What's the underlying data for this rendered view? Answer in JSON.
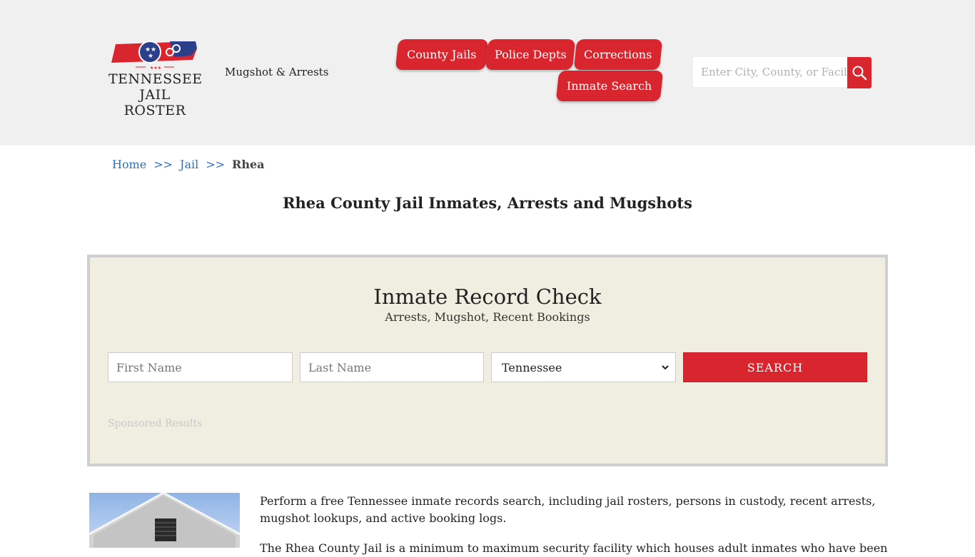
{
  "header": {
    "logo_line1": "TENNESSEE",
    "logo_line2": "JAIL ROSTER",
    "tagline": "Mugshot & Arrests",
    "nav": {
      "county_jails": "County Jails",
      "police_depts": "Police Depts",
      "corrections": "Corrections",
      "inmate_search": "Inmate Search"
    },
    "search_placeholder": "Enter City, County, or Facil"
  },
  "breadcrumb": {
    "home": "Home",
    "sep": ">>",
    "jail": "Jail",
    "current": "Rhea"
  },
  "page_title": "Rhea County Jail Inmates, Arrests and Mugshots",
  "record_check": {
    "title": "Inmate Record Check",
    "subtitle": "Arrests, Mugshot, Recent Bookings",
    "first_name_placeholder": "First Name",
    "last_name_placeholder": "Last Name",
    "state_selected": "Tennessee",
    "search_button": "SEARCH",
    "sponsored": "Sponsored Results"
  },
  "content": {
    "paragraph1": "Perform a free Tennessee inmate records search, including jail rosters, persons in custody, recent arrests, mugshot lookups, and active booking logs.",
    "paragraph2": "The Rhea County Jail is a minimum to maximum security facility which houses adult inmates who have been"
  },
  "colors": {
    "brand_red": "#d9262e",
    "link_blue": "#2a6fc9",
    "panel_bg": "#f0eee0",
    "header_bg": "#f0f0f0"
  }
}
